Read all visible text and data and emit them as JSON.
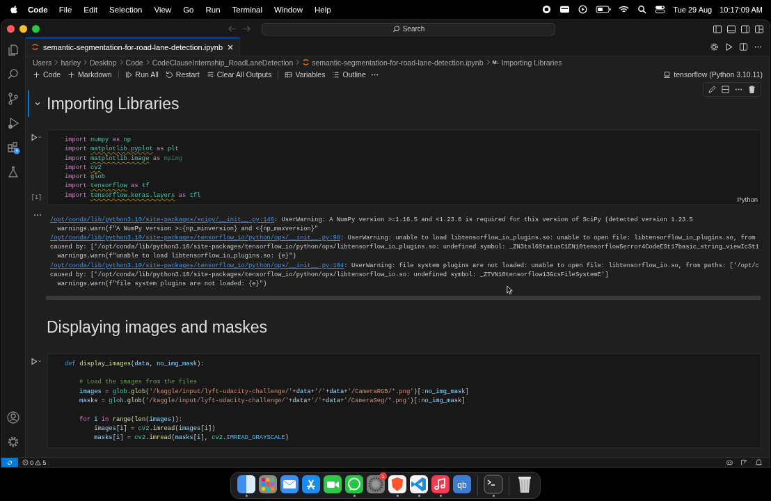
{
  "menu_bar": {
    "app": "Code",
    "items": [
      "File",
      "Edit",
      "Selection",
      "View",
      "Go",
      "Run",
      "Terminal",
      "Window",
      "Help"
    ],
    "date": "Tue 29 Aug",
    "time": "10:17:09 AM"
  },
  "title_bar": {
    "search": "Search"
  },
  "tab": {
    "label": "semantic-segmentation-for-road-lane-detection.ipynb",
    "selected": true
  },
  "breadcrumb": [
    {
      "kind": "folder",
      "label": "Users"
    },
    {
      "kind": "folder",
      "label": "harley"
    },
    {
      "kind": "folder",
      "label": "Desktop"
    },
    {
      "kind": "folder",
      "label": "Code"
    },
    {
      "kind": "folder",
      "label": "CodeClauseInternship_RoadLaneDetection"
    },
    {
      "kind": "notebook",
      "label": "semantic-segmentation-for-road-lane-detection.ipynb"
    },
    {
      "kind": "markdown",
      "badge": "M↓",
      "label": "Importing Libraries"
    }
  ],
  "toolbar": [
    {
      "kind": "add",
      "label": "Code"
    },
    {
      "kind": "add",
      "label": "Markdown"
    },
    {
      "kind": "separator"
    },
    {
      "kind": "run",
      "label": "Run All"
    },
    {
      "kind": "restart",
      "label": "Restart"
    },
    {
      "kind": "clear",
      "label": "Clear All Outputs"
    },
    {
      "kind": "separator"
    },
    {
      "kind": "variables",
      "label": "Variables"
    },
    {
      "kind": "outline",
      "label": "Outline"
    }
  ],
  "kernel": "tensorflow (Python 3.10.11)",
  "cells": [
    {
      "kind": "markdown",
      "selected": true,
      "heading": "Importing Libraries"
    },
    {
      "kind": "code",
      "selected": false,
      "exec": "[1]",
      "language": "Python",
      "lines": [
        {
          "gap_before": false,
          "tokens": [
            {
              "kind": "kw",
              "t": "import "
            },
            {
              "kind": "mod",
              "t": "numpy"
            },
            {
              "kind": "kw",
              "t": " as "
            },
            {
              "kind": "mod",
              "t": "np"
            }
          ]
        },
        {
          "gap_before": false,
          "tokens": [
            {
              "kind": "kw",
              "t": "import "
            },
            {
              "kind": "modw",
              "t": "matplotlib.pyplot"
            },
            {
              "kind": "kw",
              "t": " as "
            },
            {
              "kind": "mod",
              "t": "plt"
            }
          ]
        },
        {
          "gap_before": false,
          "tokens": [
            {
              "kind": "kw",
              "t": "import "
            },
            {
              "kind": "modw",
              "t": "matplotlib.image"
            },
            {
              "kind": "kw",
              "t": " as "
            },
            {
              "kind": "dim",
              "t": "mpimg"
            }
          ]
        },
        {
          "gap_before": false,
          "tokens": [
            {
              "kind": "kw",
              "t": "import "
            },
            {
              "kind": "modw",
              "t": "cv2"
            }
          ]
        },
        {
          "gap_before": false,
          "tokens": [
            {
              "kind": "kw",
              "t": "import "
            },
            {
              "kind": "mod",
              "t": "glob"
            }
          ]
        },
        {
          "gap_before": false,
          "tokens": [
            {
              "kind": "kw",
              "t": "import "
            },
            {
              "kind": "modw",
              "t": "tensorflow"
            },
            {
              "kind": "kw",
              "t": " as "
            },
            {
              "kind": "mod",
              "t": "tf"
            }
          ]
        },
        {
          "gap_before": false,
          "tokens": [
            {
              "kind": "kw",
              "t": "import "
            },
            {
              "kind": "modw",
              "t": "tensorflow.keras.layers"
            },
            {
              "kind": "kw",
              "t": " as "
            },
            {
              "kind": "mod",
              "t": "tfl"
            }
          ]
        }
      ]
    },
    {
      "kind": "output",
      "selected": false,
      "lines": [
        [
          {
            "kind": "link",
            "t": "/opt/conda/lib/python3.10/site-packages/scipy/__init__.py:146"
          },
          {
            "kind": "text",
            "t": ": UserWarning: A NumPy version >=1.16.5 and <1.23.0 is required for this version of SciPy (detected version 1.23.5"
          }
        ],
        [
          {
            "kind": "text",
            "t": "  warnings.warn(f\"A NumPy version >={np_minversion} and <{np_maxversion}\""
          }
        ],
        [
          {
            "kind": "link",
            "t": "/opt/conda/lib/python3.10/site-packages/tensorflow_io/python/ops/__init__.py:98"
          },
          {
            "kind": "text",
            "t": ": UserWarning: unable to load libtensorflow_io_plugins.so: unable to open file: libtensorflow_io_plugins.so, from"
          }
        ],
        [
          {
            "kind": "text",
            "t": "caused by: ['/opt/conda/lib/python3.10/site-packages/tensorflow_io/python/ops/libtensorflow_io_plugins.so: undefined symbol: _ZN3tsl6StatusC1EN10tensorflow5error4CodeESt17basic_string_viewIcSt1"
          }
        ],
        [
          {
            "kind": "text",
            "t": "  warnings.warn(f\"unable to load libtensorflow_io_plugins.so: {e}\")"
          }
        ],
        [
          {
            "kind": "link",
            "t": "/opt/conda/lib/python3.10/site-packages/tensorflow_io/python/ops/__init__.py:104"
          },
          {
            "kind": "text",
            "t": ": UserWarning: file system plugins are not loaded: unable to open file: libtensorflow_io.so, from paths: ['/opt/c"
          }
        ],
        [
          {
            "kind": "text",
            "t": "caused by: ['/opt/conda/lib/python3.10/site-packages/tensorflow_io/python/ops/libtensorflow_io.so: undefined symbol: _ZTVN10tensorflow13GcsFileSystemE']"
          }
        ],
        [
          {
            "kind": "text",
            "t": "  warnings.warn(f\"file system plugins are not loaded: {e}\")"
          }
        ]
      ]
    },
    {
      "kind": "markdown",
      "selected": false,
      "heading": "Displaying images and maskes"
    },
    {
      "kind": "code",
      "selected": false,
      "lines": [
        {
          "gap_before": false,
          "tokens": [
            {
              "kind": "def",
              "t": "def "
            },
            {
              "kind": "fn",
              "t": "display_images"
            },
            {
              "kind": "plain",
              "t": "("
            },
            {
              "kind": "var",
              "t": "data"
            },
            {
              "kind": "plain",
              "t": ", "
            },
            {
              "kind": "var",
              "t": "no_img_mask"
            },
            {
              "kind": "plain",
              "t": "):"
            }
          ]
        },
        {
          "gap_before": true,
          "tokens": [
            {
              "kind": "cmt",
              "t": "    # Load the images from the files"
            }
          ]
        },
        {
          "gap_before": false,
          "tokens": [
            {
              "kind": "var",
              "t": "    images"
            },
            {
              "kind": "plain",
              "t": " = "
            },
            {
              "kind": "mod",
              "t": "glob"
            },
            {
              "kind": "plain",
              "t": "."
            },
            {
              "kind": "fn",
              "t": "glob"
            },
            {
              "kind": "plain",
              "t": "("
            },
            {
              "kind": "str",
              "t": "'/kaggle/input/lyft-udacity-challenge/'"
            },
            {
              "kind": "plain",
              "t": "+"
            },
            {
              "kind": "var",
              "t": "data"
            },
            {
              "kind": "plain",
              "t": "+"
            },
            {
              "kind": "str",
              "t": "'/'"
            },
            {
              "kind": "plain",
              "t": "+"
            },
            {
              "kind": "var",
              "t": "data"
            },
            {
              "kind": "plain",
              "t": "+"
            },
            {
              "kind": "str",
              "t": "'/CameraRGB/*.png'"
            },
            {
              "kind": "plain",
              "t": ")[:"
            },
            {
              "kind": "var",
              "t": "no_img_mask"
            },
            {
              "kind": "plain",
              "t": "]"
            }
          ]
        },
        {
          "gap_before": false,
          "tokens": [
            {
              "kind": "var",
              "t": "    masks"
            },
            {
              "kind": "plain",
              "t": " = "
            },
            {
              "kind": "mod",
              "t": "glob"
            },
            {
              "kind": "plain",
              "t": "."
            },
            {
              "kind": "fn",
              "t": "glob"
            },
            {
              "kind": "plain",
              "t": "("
            },
            {
              "kind": "str",
              "t": "'/kaggle/input/lyft-udacity-challenge/'"
            },
            {
              "kind": "plain",
              "t": "+"
            },
            {
              "kind": "var",
              "t": "data"
            },
            {
              "kind": "plain",
              "t": "+"
            },
            {
              "kind": "str",
              "t": "'/'"
            },
            {
              "kind": "plain",
              "t": "+"
            },
            {
              "kind": "var",
              "t": "data"
            },
            {
              "kind": "plain",
              "t": "+"
            },
            {
              "kind": "str",
              "t": "'/CameraSeg/*.png'"
            },
            {
              "kind": "plain",
              "t": ")[:"
            },
            {
              "kind": "var",
              "t": "no_img_mask"
            },
            {
              "kind": "plain",
              "t": "]"
            }
          ]
        },
        {
          "gap_before": true,
          "tokens": [
            {
              "kind": "kw",
              "t": "    for "
            },
            {
              "kind": "var",
              "t": "i"
            },
            {
              "kind": "kw",
              "t": " in "
            },
            {
              "kind": "fn",
              "t": "range"
            },
            {
              "kind": "plain",
              "t": "("
            },
            {
              "kind": "fn",
              "t": "len"
            },
            {
              "kind": "plain",
              "t": "("
            },
            {
              "kind": "var",
              "t": "images"
            },
            {
              "kind": "plain",
              "t": ")):"
            }
          ]
        },
        {
          "gap_before": false,
          "tokens": [
            {
              "kind": "var",
              "t": "        images"
            },
            {
              "kind": "plain",
              "t": "["
            },
            {
              "kind": "var",
              "t": "i"
            },
            {
              "kind": "plain",
              "t": "] = "
            },
            {
              "kind": "mod",
              "t": "cv2"
            },
            {
              "kind": "plain",
              "t": "."
            },
            {
              "kind": "fn",
              "t": "imread"
            },
            {
              "kind": "plain",
              "t": "("
            },
            {
              "kind": "var",
              "t": "images"
            },
            {
              "kind": "plain",
              "t": "["
            },
            {
              "kind": "var",
              "t": "i"
            },
            {
              "kind": "plain",
              "t": "])"
            }
          ]
        },
        {
          "gap_before": false,
          "tokens": [
            {
              "kind": "var",
              "t": "        masks"
            },
            {
              "kind": "plain",
              "t": "["
            },
            {
              "kind": "var",
              "t": "i"
            },
            {
              "kind": "plain",
              "t": "] = "
            },
            {
              "kind": "mod",
              "t": "cv2"
            },
            {
              "kind": "plain",
              "t": "."
            },
            {
              "kind": "fn",
              "t": "imread"
            },
            {
              "kind": "plain",
              "t": "("
            },
            {
              "kind": "var",
              "t": "masks"
            },
            {
              "kind": "plain",
              "t": "["
            },
            {
              "kind": "var",
              "t": "i"
            },
            {
              "kind": "plain",
              "t": "], "
            },
            {
              "kind": "mod",
              "t": "cv2"
            },
            {
              "kind": "plain",
              "t": "."
            },
            {
              "kind": "const",
              "t": "IMREAD_GRAYSCALE"
            },
            {
              "kind": "plain",
              "t": ")"
            }
          ]
        }
      ]
    }
  ],
  "status_bar": {
    "errors": "0",
    "warnings": "5"
  },
  "dock": [
    {
      "kind": "finder",
      "running": true
    },
    {
      "kind": "launchpad",
      "running": false
    },
    {
      "kind": "mail",
      "running": false
    },
    {
      "kind": "appstore",
      "running": false
    },
    {
      "kind": "facetime",
      "running": false
    },
    {
      "kind": "whatsapp",
      "running": true
    },
    {
      "kind": "settings",
      "running": false,
      "badge": "1"
    },
    {
      "kind": "brave",
      "running": true
    },
    {
      "kind": "vscode",
      "running": true
    },
    {
      "kind": "music",
      "running": true
    },
    {
      "kind": "qbittorrent",
      "running": false,
      "label": "qb"
    },
    {
      "kind": "divider"
    },
    {
      "kind": "terminal",
      "running": true
    },
    {
      "kind": "divider"
    },
    {
      "kind": "trash",
      "running": false
    }
  ]
}
